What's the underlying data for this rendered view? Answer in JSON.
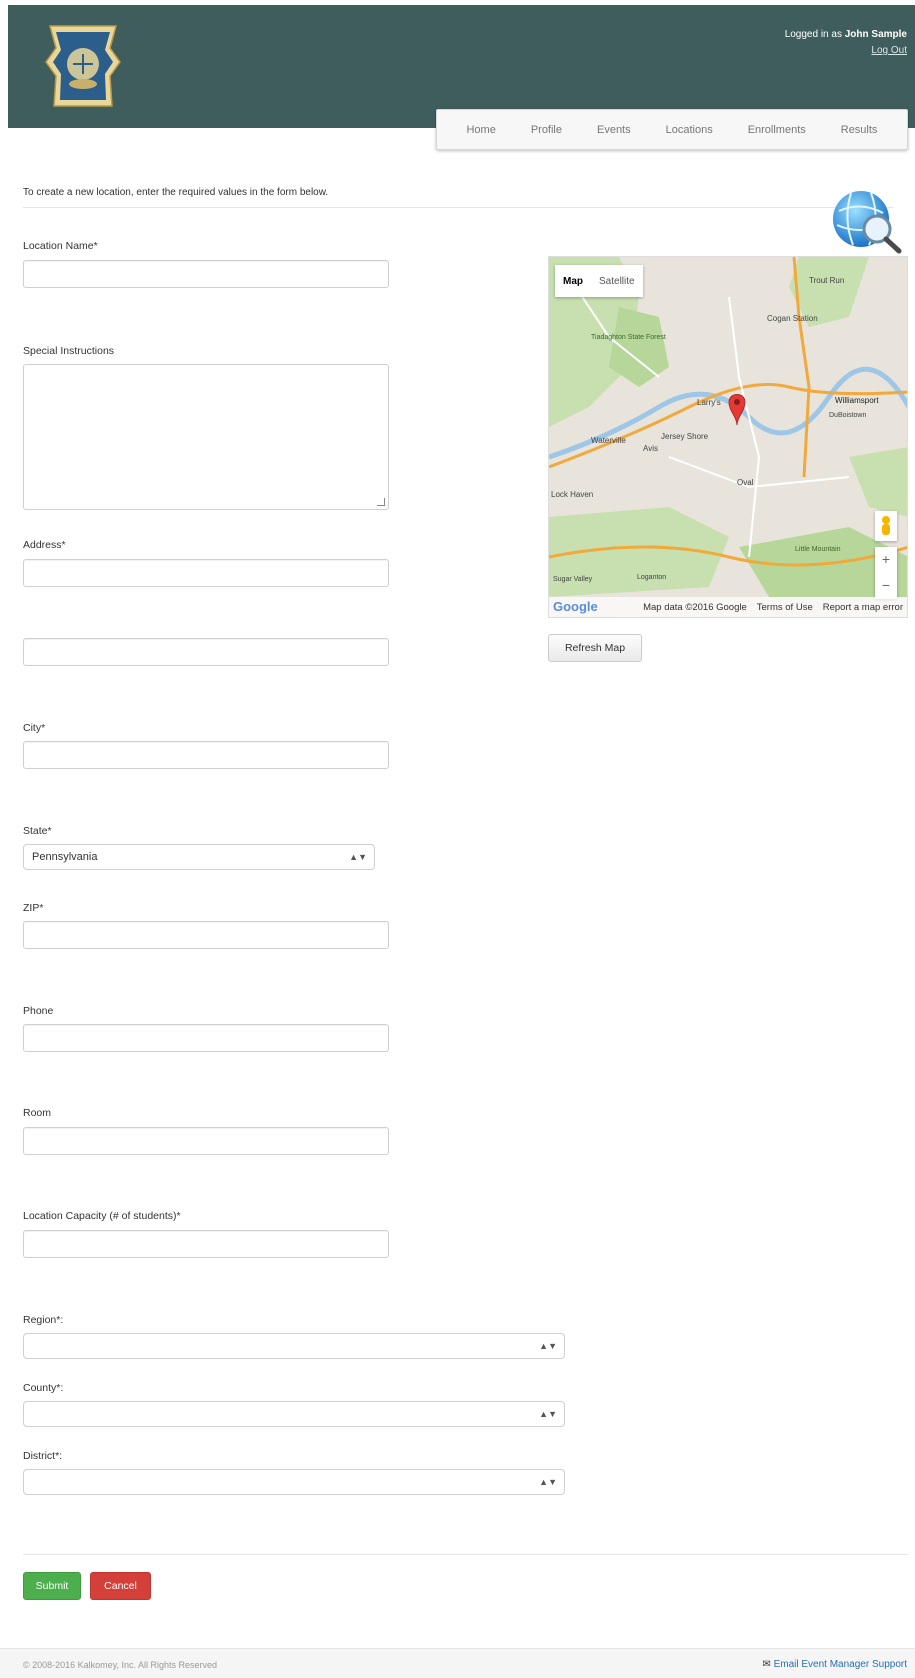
{
  "header": {
    "logged_in_prefix": "Logged in as",
    "user_name": "John Sample",
    "logout_label": "Log Out",
    "band_color": "#3f5d5d"
  },
  "nav": {
    "items": [
      "Home",
      "Profile",
      "Events",
      "Locations",
      "Enrollments",
      "Results"
    ]
  },
  "intro_text": "To create a new location, enter the required values in the form below.",
  "form": {
    "location_name_label": "Location Name*",
    "special_instructions_label": "Special Instructions",
    "address_label": "Address*",
    "city_label": "City*",
    "state_label": "State*",
    "state_value": "Pennsylvania",
    "zip_label": "ZIP*",
    "phone_label": "Phone",
    "room_label": "Room",
    "capacity_label": "Location Capacity (# of students)*",
    "region_label": "Region*:",
    "county_label": "County*:",
    "district_label": "District*:"
  },
  "map": {
    "type_map": "Map",
    "type_satellite": "Satellite",
    "attribution": "Map data ©2016 Google",
    "terms": "Terms of Use",
    "report": "Report a map error",
    "google": "Google",
    "places": [
      "Trout Run",
      "Cogan Station",
      "Tiadaghton State Forest",
      "Larry's",
      "Williamsport",
      "DuBoistown",
      "Waterville",
      "Jersey Shore",
      "Avis",
      "Oval",
      "Lock Haven",
      "Loganton",
      "Sugar Valley",
      "Little Mountain"
    ],
    "refresh_label": "Refresh Map"
  },
  "buttons": {
    "submit": "Submit",
    "cancel": "Cancel"
  },
  "footer": {
    "copyright": "© 2008-2016 Kalkomey, Inc. All Rights Reserved",
    "support": "Email Event Manager Support"
  }
}
